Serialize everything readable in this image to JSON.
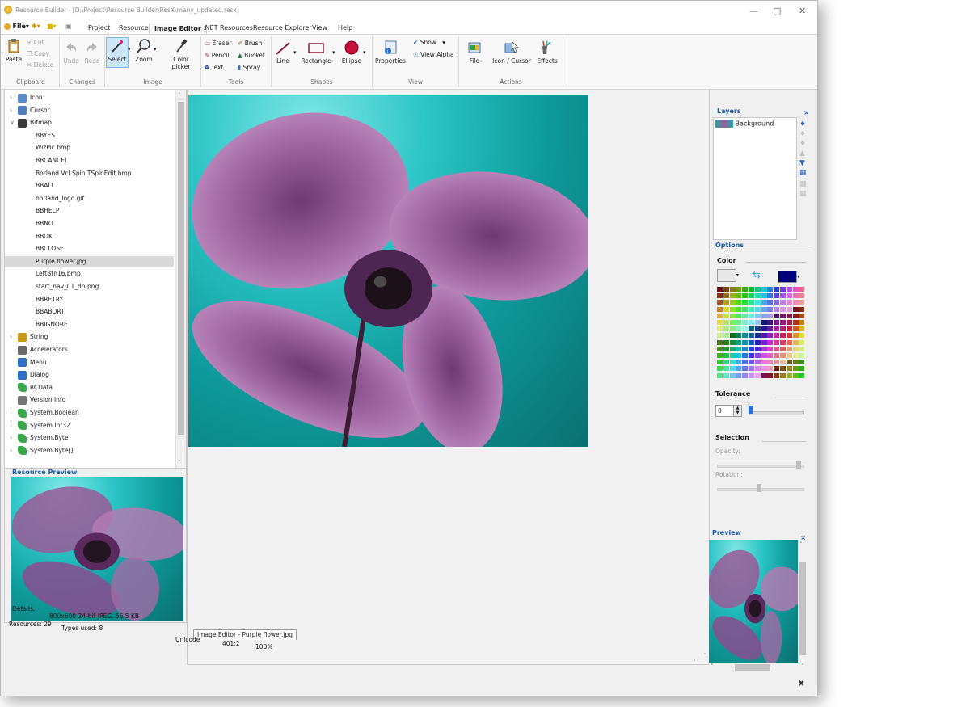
{
  "window": {
    "title": "Resource Builder - [D:\\Project\\Resource Builder\\ResX\\many_updated.resx]"
  },
  "menu": {
    "file_label": "File",
    "tabs": [
      {
        "label": "Project",
        "active": false
      },
      {
        "label": "Resources",
        "active": false
      },
      {
        "label": "Image Editor",
        "active": true
      },
      {
        "label": ".NET Resources",
        "active": false
      },
      {
        "label": "Resource Explorer",
        "active": false
      },
      {
        "label": "View",
        "active": false
      },
      {
        "label": "Help",
        "active": false
      }
    ]
  },
  "ribbon": {
    "clipboard": {
      "label": "Clipboard",
      "paste": "Paste",
      "cut": "Cut",
      "copy": "Copy",
      "delete": "Delete"
    },
    "changes": {
      "label": "Changes",
      "undo": "Undo",
      "redo": "Redo"
    },
    "image": {
      "label": "Image",
      "select": "Select",
      "zoom": "Zoom",
      "color_picker": "Color picker"
    },
    "tools": {
      "label": "Tools",
      "eraser": "Eraser",
      "pencil": "Pencil",
      "text": "Text",
      "brush": "Brush",
      "bucket": "Bucket",
      "spray": "Spray"
    },
    "shapes": {
      "label": "Shapes",
      "line": "Line",
      "rectangle": "Rectangle",
      "ellipse": "Ellipse"
    },
    "view": {
      "label": "View",
      "properties": "Properties",
      "show": "Show",
      "view_alpha": "View Alpha"
    },
    "actions": {
      "label": "Actions",
      "file": "File",
      "icon_cursor": "Icon / Cursor",
      "effects": "Effects"
    }
  },
  "tree": {
    "items": [
      {
        "label": "Icon",
        "level": 0,
        "expander": ">",
        "icon": "icon-folder-icon",
        "highlighted": false
      },
      {
        "label": "Cursor",
        "level": 0,
        "expander": ">",
        "icon": "cursor-folder-icon",
        "highlighted": false
      },
      {
        "label": "Bitmap",
        "level": 0,
        "expander": "v",
        "icon": "bitmap-folder-icon",
        "highlighted": false
      },
      {
        "label": "BBYES",
        "level": 1,
        "expander": "",
        "icon": "",
        "highlighted": false
      },
      {
        "label": "WizPic.bmp",
        "level": 1,
        "expander": "",
        "icon": "",
        "highlighted": false
      },
      {
        "label": "BBCANCEL",
        "level": 1,
        "expander": "",
        "icon": "",
        "highlighted": false
      },
      {
        "label": "Borland.Vcl.Spin.TSpinEdit.bmp",
        "level": 1,
        "expander": "",
        "icon": "",
        "highlighted": false
      },
      {
        "label": "BBALL",
        "level": 1,
        "expander": "",
        "icon": "",
        "highlighted": false
      },
      {
        "label": "borland_logo.gif",
        "level": 1,
        "expander": "",
        "icon": "",
        "highlighted": false
      },
      {
        "label": "BBHELP",
        "level": 1,
        "expander": "",
        "icon": "",
        "highlighted": false
      },
      {
        "label": "BBNO",
        "level": 1,
        "expander": "",
        "icon": "",
        "highlighted": false
      },
      {
        "label": "BBOK",
        "level": 1,
        "expander": "",
        "icon": "",
        "highlighted": false
      },
      {
        "label": "BBCLOSE",
        "level": 1,
        "expander": "",
        "icon": "",
        "highlighted": false
      },
      {
        "label": "Purple flower.jpg",
        "level": 1,
        "expander": "",
        "icon": "",
        "highlighted": true
      },
      {
        "label": "LeftBtn16.bmp",
        "level": 1,
        "expander": "",
        "icon": "",
        "highlighted": false
      },
      {
        "label": "start_nav_01_dn.png",
        "level": 1,
        "expander": "",
        "icon": "",
        "highlighted": false
      },
      {
        "label": "BBRETRY",
        "level": 1,
        "expander": "",
        "icon": "",
        "highlighted": false
      },
      {
        "label": "BBABORT",
        "level": 1,
        "expander": "",
        "icon": "",
        "highlighted": false
      },
      {
        "label": "BBIGNORE",
        "level": 1,
        "expander": "",
        "icon": "",
        "highlighted": false
      },
      {
        "label": "String",
        "level": 0,
        "expander": ">",
        "icon": "string-icon",
        "highlighted": false
      },
      {
        "label": "Accelerators",
        "level": 0,
        "expander": "",
        "icon": "accelerators-icon",
        "highlighted": false
      },
      {
        "label": "Menu",
        "level": 0,
        "expander": "",
        "icon": "menu-icon",
        "highlighted": false
      },
      {
        "label": "Dialog",
        "level": 0,
        "expander": "",
        "icon": "dialog-icon",
        "highlighted": false
      },
      {
        "label": "RCData",
        "level": 0,
        "expander": "",
        "icon": "rcdata-icon",
        "highlighted": false
      },
      {
        "label": "Version Info",
        "level": 0,
        "expander": "",
        "icon": "version-info-icon",
        "highlighted": false
      },
      {
        "label": "System.Boolean",
        "level": 0,
        "expander": ">",
        "icon": "dotnet-type-icon",
        "highlighted": false
      },
      {
        "label": "System.Int32",
        "level": 0,
        "expander": ">",
        "icon": "dotnet-type-icon",
        "highlighted": false
      },
      {
        "label": "System.Byte",
        "level": 0,
        "expander": ">",
        "icon": "dotnet-type-icon",
        "highlighted": false
      },
      {
        "label": "System.Byte[]",
        "level": 0,
        "expander": ">",
        "icon": "dotnet-type-icon",
        "highlighted": false
      }
    ]
  },
  "resource_preview": {
    "title": "Resource Preview",
    "details_label": "Details:",
    "details_value": "800x600 24-bit JPEG, 56,5 KB"
  },
  "editor": {
    "doc_tab": "Image Editor - Purple flower.jpg"
  },
  "layers": {
    "title": "Layers",
    "items": [
      "Background"
    ]
  },
  "options": {
    "title": "Options",
    "color_label": "Color",
    "tolerance_label": "Tolerance",
    "tolerance_value": "0",
    "selection_label": "Selection",
    "opacity_label": "Opacity:",
    "rotation_label": "Rotation:",
    "primary_color": "#e8e8e8",
    "secondary_color": "#00007a"
  },
  "preview": {
    "title": "Preview"
  },
  "status": {
    "resources": "Resources: 29",
    "types": "Types used: 8",
    "encoding": "Unicode",
    "position": "401:2",
    "zoom": "100%"
  }
}
